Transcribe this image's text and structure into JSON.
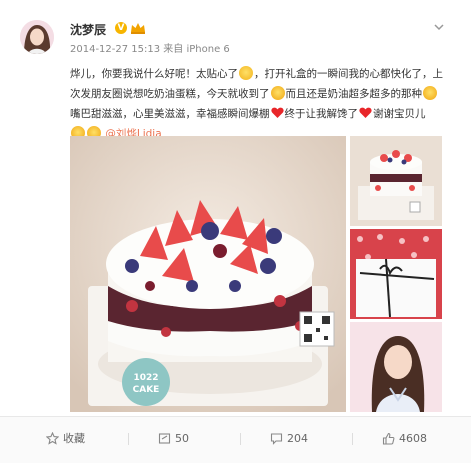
{
  "post": {
    "author": "沈梦辰",
    "meta": "2014-12-27 15:13 来自 iPhone 6",
    "lines": [
      "烨儿，你要我说什么好呢！太贴心了",
      "，打开礼盒的一瞬间我的心都快化了，上",
      "次发朋友圈说想吃奶油蛋糕，今天就收到了",
      "而且还是奶油超多超多的那种",
      "嘴巴甜滋滋，心里美滋滋，幸福感瞬间爆棚",
      "终于让我解馋了",
      "谢谢宝贝儿",
      "@刘烨Lidia"
    ]
  },
  "images": {
    "cake_label": "1022 CAKE"
  },
  "actions": {
    "favorite": "收藏",
    "repost": "50",
    "comment": "204",
    "like": "4608"
  },
  "icons": [
    "verified-v-icon",
    "crown-badge-icon",
    "chevron-down-icon",
    "star-icon",
    "repost-icon",
    "comment-icon",
    "like-icon"
  ],
  "colors": {
    "mention": "#eb7350",
    "badge": "#f7b500",
    "text": "#333333",
    "meta": "#888888"
  }
}
